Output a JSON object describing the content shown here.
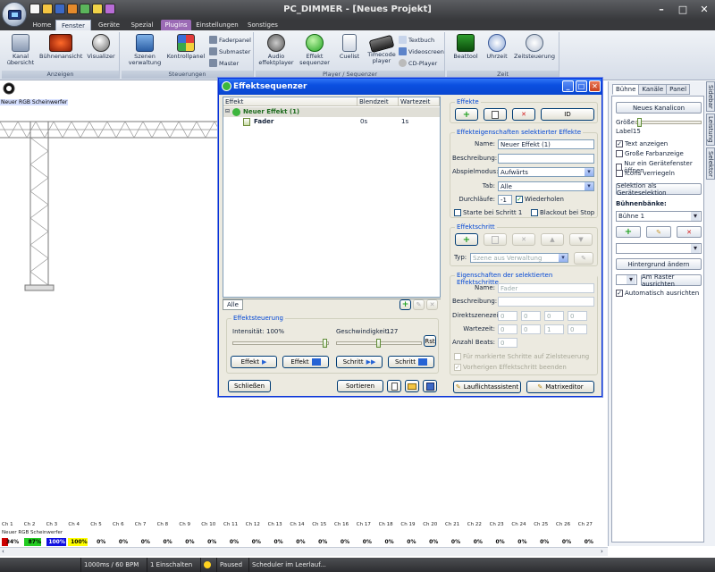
{
  "window": {
    "title": "PC_DIMMER - [Neues Projekt]"
  },
  "ribbon": {
    "tabs": [
      "Home",
      "Fenster",
      "Geräte",
      "Spezial",
      "Plugins",
      "Einstellungen",
      "Sonstiges"
    ],
    "groups": {
      "anzeigen": {
        "caption": "Anzeigen",
        "buttons": [
          "Kanal übersicht",
          "Bühnenansicht",
          "Visualizer"
        ]
      },
      "steuerungen": {
        "caption": "Steuerungen",
        "buttons": [
          "Szenen verwaltung",
          "Kontrollpanel"
        ],
        "small": [
          "Faderpanel",
          "Submaster",
          "Master"
        ]
      },
      "player": {
        "caption": "Player / Sequenzer",
        "buttons": [
          "Audio effektplayer",
          "Effekt sequenzer",
          "Cuelist",
          "Timecode player"
        ],
        "small": [
          "Textbuch",
          "Videoscreen",
          "CD-Player"
        ]
      },
      "zeit": {
        "caption": "Zeit",
        "buttons": [
          "Beattool",
          "Uhrzeit",
          "Zeitsteuerung"
        ]
      }
    }
  },
  "stage": {
    "device_label": "Neuer RGB Scheinwerfer"
  },
  "dialog": {
    "title": "Effektsequenzer",
    "list_headers": [
      "Effekt",
      "Blendzeit",
      "Wartezeit"
    ],
    "rows": [
      {
        "name": "Neuer Effekt (1)",
        "blend": "",
        "wait": ""
      },
      {
        "name": "Fader",
        "blend": "0s",
        "wait": "1s"
      }
    ],
    "tab_all": "Alle",
    "effekte_caption": "Effekte",
    "id_label": "ID",
    "props_caption": "Effekteigenschaften selektierter Effekte",
    "name_label": "Name:",
    "name_value": "Neuer Effekt (1)",
    "desc_label": "Beschreibung:",
    "mode_label": "Abspielmodus:",
    "mode_value": "Aufwärts",
    "tab_label": "Tab:",
    "tab_value": "Alle",
    "runs_label": "Durchläufe:",
    "runs_value": "-1",
    "repeat_label": "Wiederholen",
    "start_step_label": "Starte bei Schritt 1",
    "blackout_label": "Blackout bei Stop",
    "step_caption": "Effektschritt",
    "type_label": "Typ:",
    "type_value": "Szene aus Verwaltung",
    "stepprops_caption": "Eigenschaften der selektierten Effektschritte",
    "sp_name_label": "Name:",
    "sp_name_value": "Fader",
    "sp_desc_label": "Beschreibung:",
    "direct_label": "Direktszenezeit:",
    "direct_values": [
      "0",
      "0",
      "0",
      "0"
    ],
    "wait_label": "Wartezeit:",
    "wait_values": [
      "0",
      "0",
      "1",
      "0"
    ],
    "beats_label": "Anzahl Beats:",
    "beats_value": "0",
    "for_marked_label": "Für markierte Schritte auf Zielsteuerung",
    "finish_prev_label": "Vorherigen Effektschritt beenden",
    "control_caption": "Effektsteuerung",
    "intensity_label": "Intensität:",
    "intensity_value": "100%",
    "speed_label": "Geschwindigkeit:",
    "speed_value": "127",
    "rst_label": "Rst",
    "intensity_level": 1.0,
    "speed_level": 0.5,
    "btn_effekt1": "Effekt",
    "btn_effekt2": "Effekt",
    "btn_schritt1": "Schritt",
    "btn_schritt2": "Schritt",
    "btn_close": "Schließen",
    "btn_sort": "Sortieren",
    "btn_lauflicht": "Lauflichtassistent",
    "btn_matrix": "Matrixeditor"
  },
  "rightpanel": {
    "tabs": [
      "Bühne",
      "Kanäle",
      "Panel"
    ],
    "new_channel_icon": "Neues Kanalicon",
    "size_label": "Größe:",
    "label15": "Label15",
    "chk_text": "Text anzeigen",
    "chk_color": "Große Farbanzeige",
    "chk_onlydevice": "Nur ein Gerätefenster öffnen",
    "chk_lock": "Icons verriegeln",
    "sel_as_dev": "Selektion als Geräteselektion",
    "stages_label": "Bühnenbänke:",
    "stage_value": "Bühne 1",
    "bg_change": "Hintergrund ändern",
    "grid_align": "Am Raster ausrichten",
    "auto_align": "Automatisch ausrichten"
  },
  "side_tabs": [
    "Sidebar",
    "Leistung",
    "Selektor"
  ],
  "channels": {
    "labels": [
      "Ch 1",
      "Ch 2",
      "Ch 3",
      "Ch 4",
      "Ch 5",
      "Ch 6",
      "Ch 7",
      "Ch 8",
      "Ch 9",
      "Ch 10",
      "Ch 11",
      "Ch 12",
      "Ch 13",
      "Ch 14",
      "Ch 15",
      "Ch 16",
      "Ch 17",
      "Ch 18",
      "Ch 19",
      "Ch 20",
      "Ch 21",
      "Ch 22",
      "Ch 23",
      "Ch 24",
      "Ch 25",
      "Ch 26",
      "Ch 27"
    ],
    "device": "Neuer RGB Scheinwerfer",
    "values": [
      "34%",
      "87%",
      "100%",
      "100%",
      "0%",
      "0%",
      "0%",
      "0%",
      "0%",
      "0%",
      "0%",
      "0%",
      "0%",
      "0%",
      "0%",
      "0%",
      "0%",
      "0%",
      "0%",
      "0%",
      "0%",
      "0%",
      "0%",
      "0%",
      "0%",
      "0%",
      "0%"
    ]
  },
  "status": {
    "bpm": "1000ms / 60 BPM",
    "einschalten": "1 Einschalten",
    "paused": "Paused",
    "scheduler": "Scheduler im Leerlauf..."
  },
  "colors": {
    "accent": "#0b4fe0",
    "plugins_tab": "#9b6bb5",
    "ch_red": "#cc0000",
    "ch_green": "#22cc22",
    "ch_blue": "#1010e0",
    "ch_yellow": "#ffff00"
  }
}
